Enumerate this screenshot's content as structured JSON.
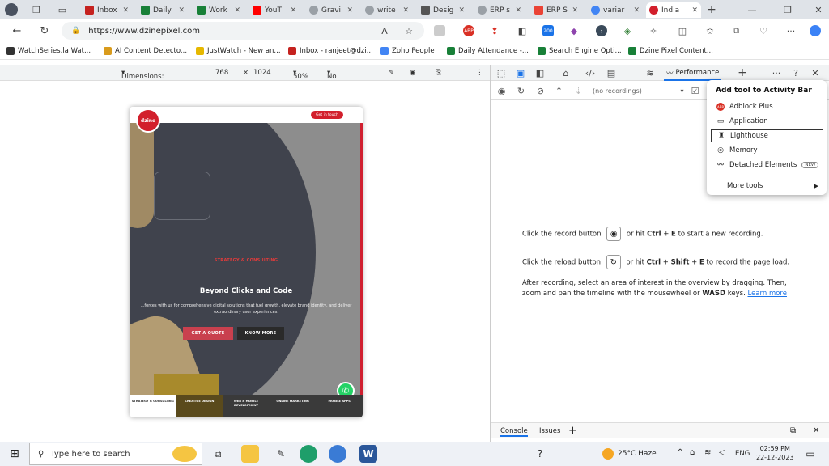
{
  "tabs": [
    {
      "label": "Inbox",
      "color": "#c5221f"
    },
    {
      "label": "Daily",
      "color": "#188038"
    },
    {
      "label": "Work",
      "color": "#188038"
    },
    {
      "label": "YouT",
      "color": "#ff0000"
    },
    {
      "label": "Gravi",
      "color": "#5f6368"
    },
    {
      "label": "write",
      "color": "#5f6368"
    },
    {
      "label": "Desig",
      "color": "#555555"
    },
    {
      "label": "ERP s",
      "color": "#5f6368"
    },
    {
      "label": "ERP S",
      "color": "#ea4335"
    },
    {
      "label": "variar",
      "color": "#4285f4"
    },
    {
      "label": "India",
      "color": "#d21f2c"
    }
  ],
  "address": {
    "url": "https://www.dzinepixel.com"
  },
  "bookmarks": [
    {
      "label": "WatchSeries.la  Wat...",
      "color": "#333333"
    },
    {
      "label": "AI Content Detecto...",
      "color": "#d99b1c"
    },
    {
      "label": "JustWatch - New an...",
      "color": "#e6b800"
    },
    {
      "label": "Inbox - ranjeet@dzi...",
      "color": "#c5221f"
    },
    {
      "label": "Zoho People",
      "color": "#4285f4"
    },
    {
      "label": "Daily Attendance -...",
      "color": "#188038"
    },
    {
      "label": "Search Engine Opti...",
      "color": "#188038"
    },
    {
      "label": "Dzine Pixel Content...",
      "color": "#188038"
    }
  ],
  "device_toolbar": {
    "dimensions": "Dimensions: iPad Mini",
    "width": "768",
    "times": "×",
    "height": "1024",
    "zoom": "50%",
    "throttle": "No throttling"
  },
  "site": {
    "logo": "dzine",
    "cta": "Get in touch",
    "kicker": "STRATEGY & CONSULTING",
    "title": "Beyond Clicks and Code",
    "subtitle": "...forces with us for comprehensive digital solutions that fuel growth, elevate brand identity, and deliver extraordinary user experiences.",
    "btn_quote": "GET A QUOTE",
    "btn_more": "KNOW MORE",
    "services": [
      "STRATEGY & CONSULTING",
      "CREATIVE DESIGN",
      "WEB & MOBILE DEVELOPMENT",
      "ONLINE MARKETING",
      "MOBILE APPS"
    ]
  },
  "devtools": {
    "active_tab": "Performance",
    "recordings": "(no recordings)",
    "line1_a": "Click the record button",
    "line1_b": "or hit",
    "line1_c": "Ctrl",
    "line1_d": "E",
    "line1_e": "to start a new recording.",
    "line2_a": "Click the reload button",
    "line2_b": "or hit",
    "line2_c": "Ctrl",
    "line2_d": "Shift",
    "line2_e": "E",
    "line2_f": "to record the page load.",
    "line3": "After recording, select an area of interest in the overview by dragging. Then,",
    "line4_a": "zoom and pan the timeline with the mousewheel or",
    "line4_b": "WASD",
    "line4_c": "keys.",
    "learn_more": "Learn more",
    "drawer_console": "Console",
    "drawer_issues": "Issues"
  },
  "popup": {
    "title": "Add tool to Activity Bar",
    "items": [
      {
        "label": "Adblock Plus"
      },
      {
        "label": "Application"
      },
      {
        "label": "Lighthouse"
      },
      {
        "label": "Memory"
      },
      {
        "label": "Detached Elements",
        "badge": "NEW"
      },
      {
        "label": "More tools"
      }
    ]
  },
  "taskbar": {
    "search_placeholder": "Type here to search",
    "weather": "25°C  Haze",
    "lang": "ENG",
    "time": "02:59 PM",
    "date": "22-12-2023"
  }
}
